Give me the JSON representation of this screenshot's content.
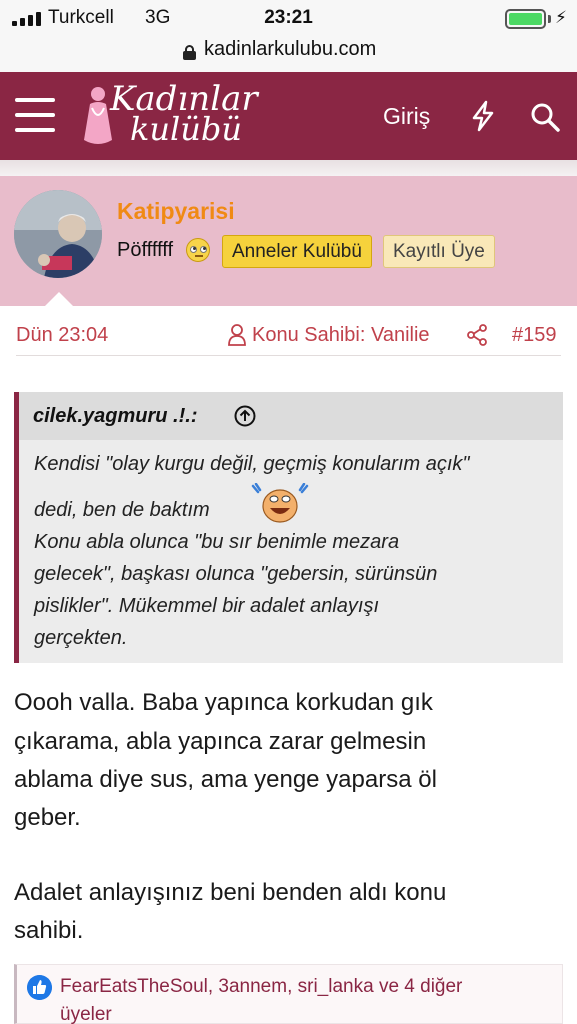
{
  "status_bar": {
    "carrier": "Turkcell",
    "network": "3G",
    "time": "23:21"
  },
  "browser": {
    "url": "kadinlarkulubu.com"
  },
  "site_header": {
    "logo_line1": "Kadınlar",
    "logo_line2": "kulübü",
    "login_label": "Giriş",
    "icons": [
      "menu-icon",
      "bolt-icon",
      "search-icon"
    ],
    "brand_color": "#8a2644"
  },
  "post": {
    "author": {
      "username": "Katipyarisi",
      "user_title": "Pöffffff",
      "badges": [
        "Anneler Kulübü",
        "Kayıtlı Üye"
      ]
    },
    "meta": {
      "date": "Dün 23:04",
      "owner_label": "Konu Sahibi: Vanilie",
      "post_number": "#159"
    },
    "quote": {
      "author": "cilek.yagmuru .!.:",
      "lines": [
        "Kendisi \"olay kurgu değil, geçmiş konularım açık\"",
        "dedi, ben de baktım",
        "Konu abla olunca \"bu sır benimle mezara",
        "gelecek\", başkası olunca \"gebersin, sürünsün",
        "pislikler\". Mükemmel bir adalet anlayışı",
        "gerçekten."
      ]
    },
    "body_lines": [
      "Oooh valla. Baba yapınca korkudan gık",
      "çıkarama, abla yapınca zarar gelmesin",
      "ablama diye sus, ama yenge yaparsa öl",
      "geber.",
      "Adalet anlayışınız beni benden aldı konu",
      "sahibi."
    ],
    "reactions": {
      "line1": "FearEatsTheSoul, 3annem, sri_lanka ve 4 diğer",
      "line2": "üyeler"
    }
  }
}
